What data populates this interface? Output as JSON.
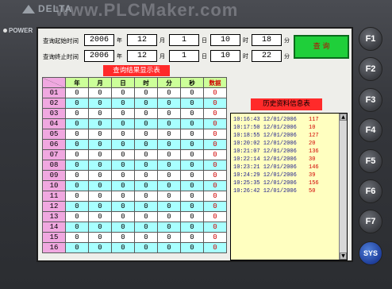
{
  "brand": {
    "logo": "DELTA",
    "watermark": "www.PLCMaker.com",
    "power_label": "POWER"
  },
  "query": {
    "start_label": "查询起始时间",
    "end_label": "查询终止时间",
    "units": [
      "年",
      "月",
      "日",
      "时",
      "分"
    ],
    "start": {
      "year": "2006",
      "month": "12",
      "day": "1",
      "hour": "10",
      "minute": "18"
    },
    "end": {
      "year": "2006",
      "month": "12",
      "day": "1",
      "hour": "10",
      "minute": "22"
    },
    "button": "查 询"
  },
  "result_table": {
    "title": "查询结果显示表",
    "headers": [
      "年",
      "月",
      "日",
      "时",
      "分",
      "秒",
      "数据"
    ],
    "rows": [
      {
        "idx": "01",
        "vals": [
          "0",
          "0",
          "0",
          "0",
          "0",
          "0",
          "0"
        ]
      },
      {
        "idx": "02",
        "vals": [
          "0",
          "0",
          "0",
          "0",
          "0",
          "0",
          "0"
        ]
      },
      {
        "idx": "03",
        "vals": [
          "0",
          "0",
          "0",
          "0",
          "0",
          "0",
          "0"
        ]
      },
      {
        "idx": "04",
        "vals": [
          "0",
          "0",
          "0",
          "0",
          "0",
          "0",
          "0"
        ]
      },
      {
        "idx": "05",
        "vals": [
          "0",
          "0",
          "0",
          "0",
          "0",
          "0",
          "0"
        ]
      },
      {
        "idx": "06",
        "vals": [
          "0",
          "0",
          "0",
          "0",
          "0",
          "0",
          "0"
        ]
      },
      {
        "idx": "07",
        "vals": [
          "0",
          "0",
          "0",
          "0",
          "0",
          "0",
          "0"
        ]
      },
      {
        "idx": "08",
        "vals": [
          "0",
          "0",
          "0",
          "0",
          "0",
          "0",
          "0"
        ]
      },
      {
        "idx": "09",
        "vals": [
          "0",
          "0",
          "0",
          "0",
          "0",
          "0",
          "0"
        ]
      },
      {
        "idx": "10",
        "vals": [
          "0",
          "0",
          "0",
          "0",
          "0",
          "0",
          "0"
        ]
      },
      {
        "idx": "11",
        "vals": [
          "0",
          "0",
          "0",
          "0",
          "0",
          "0",
          "0"
        ]
      },
      {
        "idx": "12",
        "vals": [
          "0",
          "0",
          "0",
          "0",
          "0",
          "0",
          "0"
        ]
      },
      {
        "idx": "13",
        "vals": [
          "0",
          "0",
          "0",
          "0",
          "0",
          "0",
          "0"
        ]
      },
      {
        "idx": "14",
        "vals": [
          "0",
          "0",
          "0",
          "0",
          "0",
          "0",
          "0"
        ]
      },
      {
        "idx": "15",
        "vals": [
          "0",
          "0",
          "0",
          "0",
          "0",
          "0",
          "0"
        ]
      },
      {
        "idx": "16",
        "vals": [
          "0",
          "0",
          "0",
          "0",
          "0",
          "0",
          "0"
        ]
      }
    ]
  },
  "history": {
    "title": "历史资料信息表",
    "rows": [
      {
        "time": "10:16:43 12/01/2006",
        "value": "117"
      },
      {
        "time": "10:17:50 12/01/2006",
        "value": "10"
      },
      {
        "time": "10:18:55 12/01/2006",
        "value": "127"
      },
      {
        "time": "10:20:02 12/01/2006",
        "value": "20"
      },
      {
        "time": "10:21:07 12/01/2006",
        "value": "136"
      },
      {
        "time": "10:22:14 12/01/2006",
        "value": "30"
      },
      {
        "time": "10:23:21 12/01/2006",
        "value": "146"
      },
      {
        "time": "10:24:29 12/01/2006",
        "value": "39"
      },
      {
        "time": "10:25:35 12/01/2006",
        "value": "156"
      },
      {
        "time": "10:26:42 12/01/2006",
        "value": "50"
      }
    ]
  },
  "function_keys": [
    "F1",
    "F2",
    "F3",
    "F4",
    "F5",
    "F6",
    "F7",
    "SYS"
  ]
}
